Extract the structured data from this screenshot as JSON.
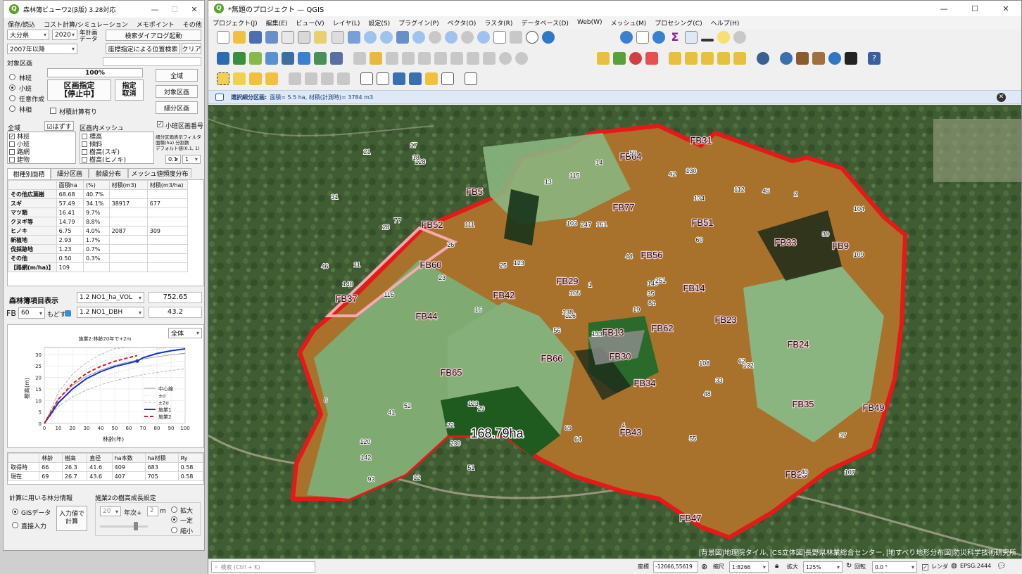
{
  "left_window": {
    "title": "森林簿ビューワ2(β版) 3.28対応",
    "menu": [
      "保存/読込",
      "コスト計算/シミュレーション",
      "メモポイント",
      "その他"
    ],
    "region_select": "大分県",
    "year_select": "2020",
    "year_plan_label1": "年計画",
    "year_plan_label2": "データ",
    "search_dialog_button": "検索ダイアログ起動",
    "period_select": "2007年以降",
    "coord_search_button": "座標指定による位置検索",
    "clear_button": "クリア",
    "target_area_label": "対象区画",
    "progress_text": "100%",
    "area_spec_button_line1": "区画指定",
    "area_spec_button_line2": "【停止中】",
    "cancel_spec_line1": "指定",
    "cancel_spec_line2": "取消",
    "radios": [
      "林班",
      "小班",
      "任意作成",
      "林相"
    ],
    "volume_calc_label": "材積計算有り",
    "all_area_button": "全域",
    "target_area_button": "対象区画",
    "sub_area_button": "細分区画",
    "all_area_label": "全域",
    "deselect_button": "☑はずす",
    "mesh_label": "区画内メッシュ",
    "subcompartment_no_label": "小班区画番号",
    "layers": [
      "林班",
      "小班",
      "路網",
      "建物"
    ],
    "mesh_items": [
      "標高",
      "傾斜",
      "樹高(スギ)",
      "樹高(ヒノキ)"
    ],
    "filter_note_line1": "細分区画表示フィルタ",
    "filter_note_line2": "面積(ha) 分割数",
    "filter_note_line3": "デフォルト値(0.1, 1)",
    "filter_value": "0.1",
    "filter_count": "1",
    "tabs": [
      "樹種別面積",
      "細分区画",
      "齢級分布",
      "メッシュ値頻度分布"
    ],
    "species_table": {
      "headers": [
        "",
        "面積ha",
        "(%)",
        "材積(m3)",
        "材積(m3/ha)"
      ],
      "rows": [
        [
          "その他広葉樹",
          "68.68",
          "40.7%",
          "",
          ""
        ],
        [
          "スギ",
          "57.49",
          "34.1%",
          "38917",
          "677"
        ],
        [
          "マツ類",
          "16.41",
          "9.7%",
          "",
          ""
        ],
        [
          "クヌギ等",
          "14.79",
          "8.8%",
          "",
          ""
        ],
        [
          "ヒノキ",
          "6.75",
          "4.0%",
          "2087",
          "309"
        ],
        [
          "新植地",
          "2.93",
          "1.7%",
          "",
          ""
        ],
        [
          "伐採跡地",
          "1.23",
          "0.7%",
          "",
          ""
        ],
        [
          "その他",
          "0.50",
          "0.3%",
          "",
          ""
        ],
        [
          "【路網(m/ha)】",
          "109",
          "",
          "",
          ""
        ]
      ]
    },
    "forest_item_label": "森林簿項目表示",
    "item1_select": "1.2 NO1_ha_VOL",
    "item1_value": "752.65",
    "fb_label": "FB",
    "fb_select": "60",
    "modosu_label": "もどす",
    "item2_select": "1.2 NO1_DBH",
    "item2_value": "43.2",
    "chart_scope_select": "全体",
    "summary_table": {
      "headers": [
        "",
        "林齢",
        "樹高",
        "直径",
        "ha本数",
        "ha材積",
        "Ry"
      ],
      "rows": [
        [
          "取得時",
          "66",
          "26.3",
          "41.6",
          "409",
          "683",
          "0.58"
        ],
        [
          "現在",
          "69",
          "26.7",
          "43.6",
          "407",
          "705",
          "0.58"
        ]
      ]
    },
    "calc_info_label": "計算に用いる林分情報",
    "gis_data_label": "GISデータ",
    "direct_input_label": "直接入力",
    "calc_input_button_line1": "入力値で",
    "calc_input_button_line2": "計算",
    "growth_setting_label": "施業2の樹高成長設定",
    "growth_years_select": "20",
    "growth_years_label": "年次+",
    "growth_m_value": "2",
    "growth_m_unit": "m",
    "growth_options": [
      "拡大",
      "一定",
      "縮小"
    ]
  },
  "chart_data": {
    "type": "line",
    "title": "施業2:林齢20年で+2m",
    "xlabel": "林齢(年)",
    "ylabel": "樹高(m)",
    "xlim": [
      0,
      100
    ],
    "ylim": [
      0,
      33
    ],
    "xticks": [
      0,
      10,
      20,
      30,
      40,
      50,
      60,
      70,
      80,
      90,
      100
    ],
    "yticks": [
      0,
      5,
      10,
      15,
      20,
      25,
      30
    ],
    "legend": [
      "中心線",
      "±σ",
      "±2σ",
      "施業1",
      "施業2"
    ],
    "legend_position": "bottom-right",
    "series": [
      {
        "name": "中心線",
        "color": "#888888",
        "x": [
          0,
          10,
          20,
          30,
          40,
          50,
          60,
          70,
          80,
          90,
          100
        ],
        "y": [
          0,
          10.5,
          16.5,
          20.5,
          23.2,
          25.2,
          26.8,
          28,
          29,
          29.8,
          30.5
        ]
      },
      {
        "name": "施業1",
        "color": "#1030d8",
        "x": [
          0,
          10,
          20,
          30,
          40,
          50,
          60,
          66,
          70,
          80,
          90,
          100
        ],
        "y": [
          0,
          9,
          15,
          19.5,
          22.5,
          24.7,
          26.2,
          27.1,
          28.5,
          30.4,
          31.6,
          32.4
        ]
      },
      {
        "name": "施業2",
        "color": "#dd1a1a",
        "x": [
          0,
          10,
          20,
          30,
          40,
          50,
          60,
          66
        ],
        "y": [
          0,
          10.5,
          17.3,
          21.8,
          24.8,
          27,
          28.6,
          29.5
        ]
      }
    ],
    "band_sigma": {
      "upper": [
        0,
        12,
        19,
        23.5,
        26.5,
        28.6,
        30.2,
        31.4,
        32.3,
        33,
        33
      ],
      "lower": [
        0,
        9,
        14,
        17.5,
        20,
        22,
        23.5,
        24.7,
        25.7,
        26.5,
        27.2
      ]
    },
    "band_2sigma": {
      "upper": [
        0,
        13.5,
        21.5,
        26.5,
        30,
        32.5,
        33,
        33,
        33,
        33,
        33
      ],
      "lower": [
        0,
        7.5,
        11.5,
        14.5,
        16.8,
        18.6,
        20,
        21.2,
        22.2,
        23,
        23.7
      ]
    },
    "marker": {
      "x": 66,
      "y": 27.1,
      "color": "#1030d8"
    }
  },
  "qgis": {
    "title": "*無題のプロジェクト — QGIS",
    "menu": [
      "プロジェクト(J)",
      "編集(E)",
      "ビュー(V)",
      "レイヤ(L)",
      "設定(S)",
      "プラグイン(P)",
      "ベクタ(O)",
      "ラスタ(R)",
      "データベース(D)",
      "Web(W)",
      "メッシュ(M)",
      "プロセシング(C)",
      "ヘルプ(H)"
    ],
    "info_bar_bold": "選択細分区画:",
    "info_bar_text": "面積= 5.5 ha, 材積(計測時)= 3784 m3",
    "map_area_label": "168.79ha",
    "attribution": "[背景図]地理院タイル, [CS立体図]長野県林業総合センター, [地すべり地形分布図]防災科学技術研究所",
    "fb_labels": [
      "FB64",
      "FB31",
      "FB5",
      "FB77",
      "FB52",
      "FB51",
      "FB60",
      "FB56",
      "FB33",
      "FB9",
      "FB29",
      "FB37",
      "FB42",
      "FB14",
      "FB44",
      "FB13",
      "FB62",
      "FB23",
      "FB30",
      "FB24",
      "FB66",
      "FB65",
      "FB34",
      "FB35",
      "FB49",
      "FB43",
      "FB25",
      "FB47"
    ],
    "stand_numbers": [
      "133",
      "28",
      "126",
      "120",
      "149",
      "29",
      "130",
      "161",
      "134",
      "19",
      "128",
      "107",
      "116",
      "104",
      "56",
      "60",
      "12",
      "103",
      "44",
      "52",
      "123",
      "142",
      "230",
      "247",
      "251",
      "132",
      "77",
      "115",
      "140",
      "108",
      "109",
      "138",
      "69",
      "105",
      "111",
      "112",
      "123",
      "40",
      "37",
      "62",
      "59",
      "25",
      "23",
      "48",
      "51",
      "46",
      "35",
      "93",
      "64",
      "84",
      "41",
      "30",
      "31",
      "33",
      "55",
      "22",
      "18",
      "21",
      "4",
      "2",
      "14",
      "16",
      "11",
      "26",
      "45",
      "17",
      "42",
      "13",
      "1",
      "6"
    ],
    "status": {
      "search_placeholder": "検索 (Ctrl + K)",
      "coord_label": "座標",
      "coord_value": "-12666,55619",
      "scale_label": "縮尺",
      "scale_value": "1:8266",
      "zoom_label": "拡大",
      "zoom_value": "125%",
      "rotation_label": "回転",
      "rotation_value": "0.0 °",
      "render_label": "レンダ",
      "crs_label": "EPSG:2444"
    }
  }
}
